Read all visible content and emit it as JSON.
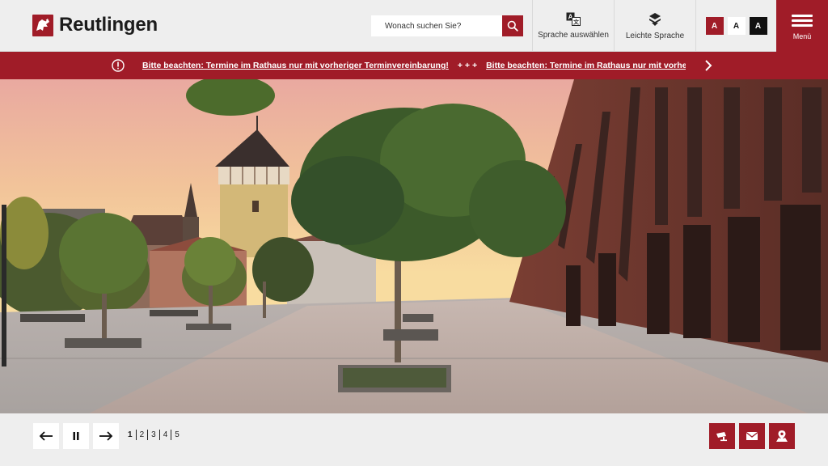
{
  "brand": {
    "name": "Reutlingen",
    "color": "#a01c28"
  },
  "search": {
    "placeholder": "Wonach suchen Sie?",
    "icon": "search-icon"
  },
  "tools": {
    "language_label": "Sprache auswählen",
    "easy_language_label": "Leichte Sprache",
    "font_sizes": [
      "A",
      "A",
      "A"
    ]
  },
  "menu": {
    "label": "Menü"
  },
  "notice": {
    "message": "Bitte beachten: Termine im Rathaus nur mit vorheriger Terminvereinbarung!",
    "separator": "+ + +",
    "message_repeat": "Bitte beachten: Termine im Rathaus nur mit vorheriger Terminvereinbarung!"
  },
  "slider": {
    "pages": [
      "1",
      "2",
      "3",
      "4",
      "5"
    ],
    "active_page": "1"
  },
  "actions": [
    "webcam-icon",
    "mail-icon",
    "map-pin-icon"
  ]
}
